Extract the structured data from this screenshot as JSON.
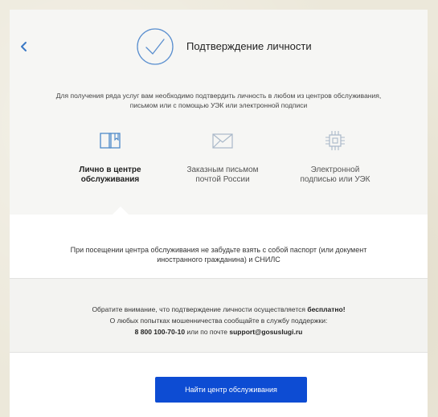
{
  "header": {
    "title": "Подтверждение личности"
  },
  "intro": {
    "line1": "Для получения ряда услуг вам необходимо подтвердить личность в любом из центров обслуживания,",
    "line2": "письмом или с помощью УЭК или электронной подписи"
  },
  "options": [
    {
      "line1": "Лично в центре",
      "line2": "обслуживания",
      "icon": "book-icon",
      "active": true
    },
    {
      "line1": "Заказным письмом",
      "line2": "почтой России",
      "icon": "envelope-icon",
      "active": false
    },
    {
      "line1": "Электронной",
      "line2": "подписью или УЭК",
      "icon": "chip-icon",
      "active": false
    }
  ],
  "info": {
    "line1": "При посещении центра обслуживания не забудьте взять с собой паспорт (или документ",
    "line2": "иностранного гражданина) и СНИЛС"
  },
  "notice": {
    "line1_prefix": "Обратите внимание, что подтверждение личности осуществляется ",
    "line1_bold": "бесплатно!",
    "line2": "О любых попытках мошенничества сообщайте в службу поддержки:",
    "phone": "8 800 100-70-10",
    "line3_middle": " или по почте ",
    "email": "support@gosuslugi.ru"
  },
  "cta": {
    "label": "Найти центр обслуживания"
  },
  "colors": {
    "accent": "#0d4cd3",
    "icon": "#4a87c8",
    "background": "#ece8da"
  }
}
